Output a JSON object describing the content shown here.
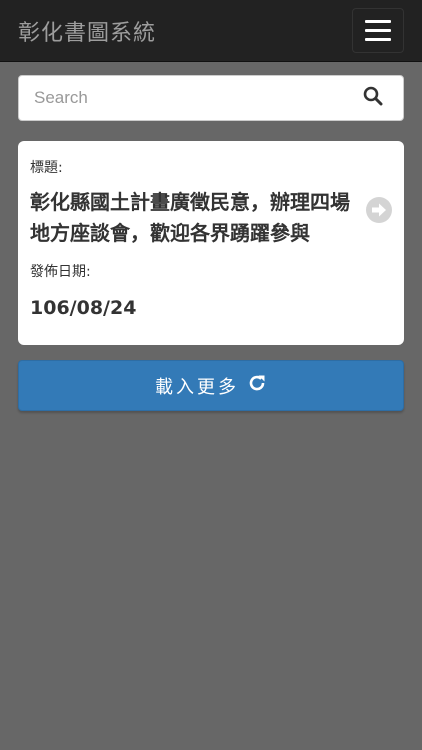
{
  "navbar": {
    "brand": "彰化書圖系統",
    "menu_icon": "hamburger-icon"
  },
  "search": {
    "placeholder": "Search",
    "icon": "search-icon"
  },
  "card": {
    "title_label": "標題:",
    "title": "彰化縣國土計畫廣徵民意，辦理四場地方座談會，歡迎各界踴躍參與",
    "date_label": "發佈日期:",
    "date": "106/08/24",
    "arrow_icon": "arrow-right-circle-icon"
  },
  "load_more": {
    "label": "載入更多",
    "icon": "refresh-icon"
  },
  "colors": {
    "navbar": "#222222",
    "background": "#676767",
    "button": "#337ab7"
  }
}
